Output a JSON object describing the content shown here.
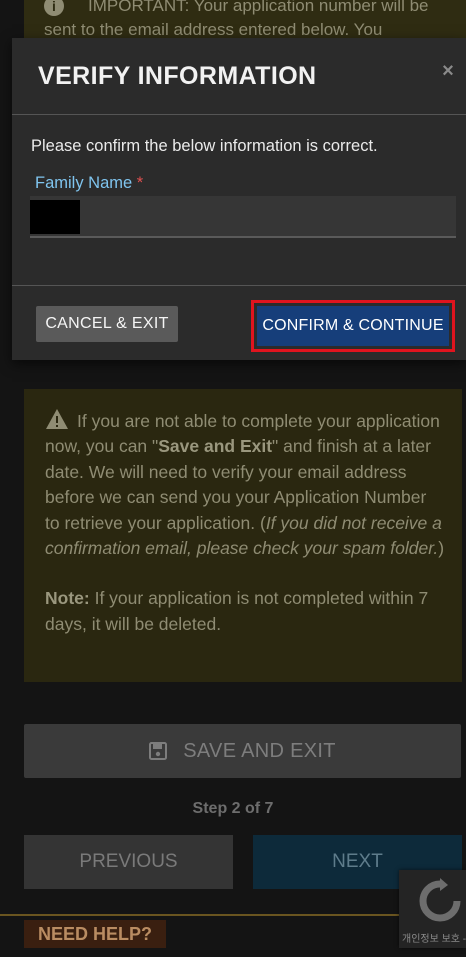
{
  "background": {
    "top_notice": "IMPORTANT: Your application number will be sent to the email address entered below. You",
    "warning": {
      "p1_a": "If you are not able to complete your application now, you can \"",
      "p1_bold": "Save and Exit",
      "p1_b": "\" and finish at a later date. We will need to verify your email address before we can send you your Application Number to retrieve your application. (",
      "p1_italic": "If you did not receive a confirmation email, please check your spam folder.",
      "p1_c": ")",
      "note_label": "Note:",
      "note_text": " If your application is not completed within 7 days, it will be deleted."
    },
    "save_exit_label": "SAVE AND EXIT",
    "step_text": "Step 2 of 7",
    "previous_label": "PREVIOUS",
    "next_label": "NEXT",
    "need_help_label": "NEED HELP?",
    "recaptcha_text": "개인정보 보호 -"
  },
  "modal": {
    "title": "VERIFY INFORMATION",
    "close_symbol": "×",
    "confirm_text": "Please confirm the below information is correct.",
    "field_label": "Family Name",
    "required_marker": "*",
    "field_value": "",
    "cancel_label": "CANCEL & EXIT",
    "confirm_label": "CONFIRM & CONTINUE"
  },
  "colors": {
    "confirm_button": "#163e7a",
    "highlight_border": "#e0141e",
    "label_blue": "#7fc4ee"
  }
}
